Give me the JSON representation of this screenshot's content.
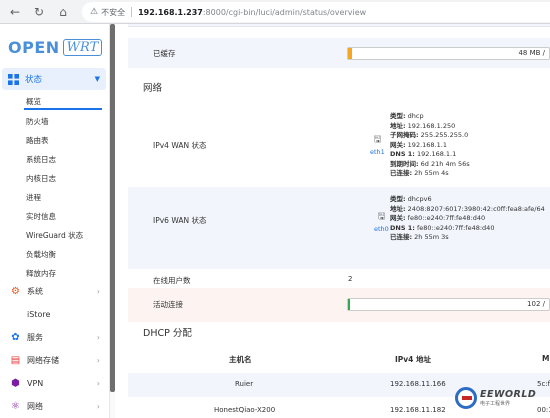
{
  "browser": {
    "security_text": "不安全",
    "url_host": "192.168.1.237",
    "url_path": ":8000/cgi-bin/luci/admin/status/overview"
  },
  "logo": {
    "part1": "OPEN",
    "part2": "WRT"
  },
  "sidebar": {
    "active": {
      "label": "状态",
      "icon": "status-grid-icon"
    },
    "sub_items": [
      "概览",
      "防火墙",
      "路由表",
      "系统日志",
      "内核日志",
      "进程",
      "实时信息",
      "WireGuard 状态",
      "负载均衡",
      "释放内存"
    ],
    "items": [
      {
        "label": "系统",
        "icon": "gear-icon",
        "color": "#e8541e"
      },
      {
        "label": "iStore",
        "icon": "",
        "color": ""
      },
      {
        "label": "服务",
        "icon": "services-icon",
        "color": "#1a73e8"
      },
      {
        "label": "网络存储",
        "icon": "storage-icon",
        "color": "#e53935"
      },
      {
        "label": "VPN",
        "icon": "vpn-icon",
        "color": "#7b1fa2"
      },
      {
        "label": "网络",
        "icon": "network-icon",
        "color": "#7b1fa2"
      }
    ]
  },
  "main": {
    "cached": {
      "label": "已缓存",
      "value": "48 MB /",
      "progress": 0.02,
      "color": "#f5a623"
    },
    "network_title": "网络",
    "ipv4": {
      "label": "IPv4 WAN 状态",
      "iface": "eth1",
      "lines": [
        [
          "类型:",
          "dhcp"
        ],
        [
          "地址:",
          "192.168.1.250"
        ],
        [
          "子网掩码:",
          "255.255.255.0"
        ],
        [
          "网关:",
          "192.168.1.1"
        ],
        [
          "DNS 1:",
          "192.168.1.1"
        ],
        [
          "到期时间:",
          "6d 21h 4m 56s"
        ],
        [
          "已连接:",
          "2h 55m 4s"
        ]
      ]
    },
    "ipv6": {
      "label": "IPv6 WAN 状态",
      "iface": "eth0",
      "lines": [
        [
          "类型:",
          "dhcpv6"
        ],
        [
          "地址:",
          "2408:8207:6017:3980:42:c0ff:fea8:afe/64"
        ],
        [
          "网关:",
          "fe80::e240:7ff:fe48:d40"
        ],
        [
          "DNS 1:",
          "fe80::e240:7ff:fe48:d40"
        ],
        [
          "已连接:",
          "2h 55m 3s"
        ]
      ]
    },
    "online_users": {
      "label": "在线用户数",
      "value": "2"
    },
    "active_conn": {
      "label": "活动连接",
      "value": "102 /",
      "progress": 0.012,
      "color": "#34a853"
    },
    "dhcp_title": "DHCP 分配",
    "dhcp_headers": [
      "主机名",
      "IPv4 地址",
      "M"
    ],
    "dhcp_rows": [
      {
        "host": "Ruier",
        "ip": "192.168.11.166",
        "mac": "5c:f9"
      },
      {
        "host": "HonestQiao-X200",
        "ip": "192.168.11.182",
        "mac": "00:1"
      }
    ]
  },
  "watermark": {
    "en": "EEWORLD",
    "cn": "电子工程世界"
  }
}
